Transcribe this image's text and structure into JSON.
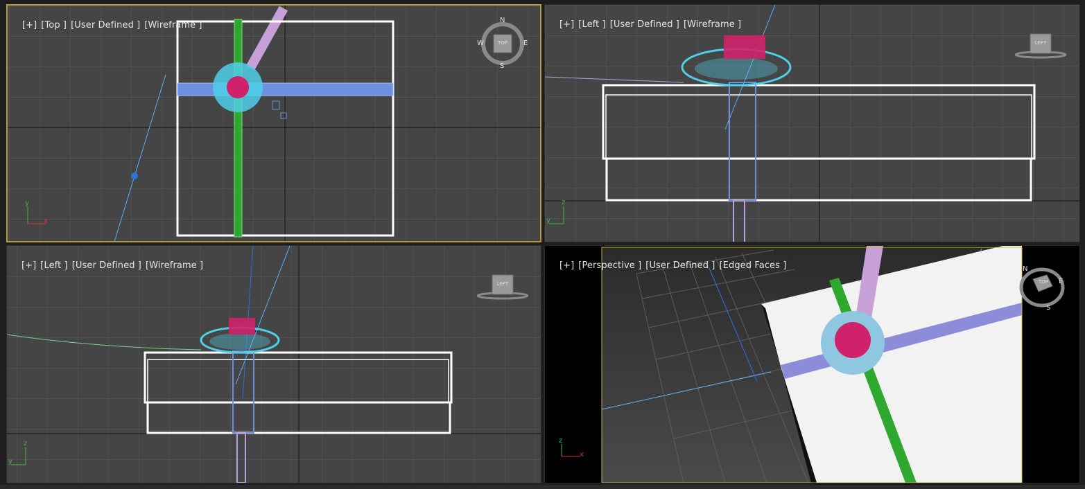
{
  "viewports": {
    "top": {
      "menu": "[+]",
      "view": "[Top ]",
      "shading_set": "[User Defined ]",
      "mode": "[Wireframe ]"
    },
    "left1": {
      "menu": "[+]",
      "view": "[Left ]",
      "shading_set": "[User Defined ]",
      "mode": "[Wireframe ]"
    },
    "left2": {
      "menu": "[+]",
      "view": "[Left ]",
      "shading_set": "[User Defined ]",
      "mode": "[Wireframe ]"
    },
    "persp": {
      "menu": "[+]",
      "view": "[Perspective ]",
      "shading_set": "[User Defined ]",
      "mode": "[Edged Faces ]"
    }
  },
  "viewcube": {
    "top_face": "TOP",
    "left_face": "LEFT",
    "compass": {
      "n": "N",
      "s": "S",
      "e": "E",
      "w": "W"
    }
  },
  "axes": {
    "x": "x",
    "y": "y",
    "z": "z"
  },
  "colors": {
    "viewport_bg": "#454545",
    "grid": "#5a5a5a",
    "active_border": "#b39a3c",
    "box": "#ffffff",
    "ribbon_green": "#2fa82f",
    "ribbon_blue": "#6f8fe0",
    "bow_cyan": "#4fcfe8",
    "bow_magenta": "#d0226a",
    "ribbon_pink": "#c8a0d8"
  }
}
